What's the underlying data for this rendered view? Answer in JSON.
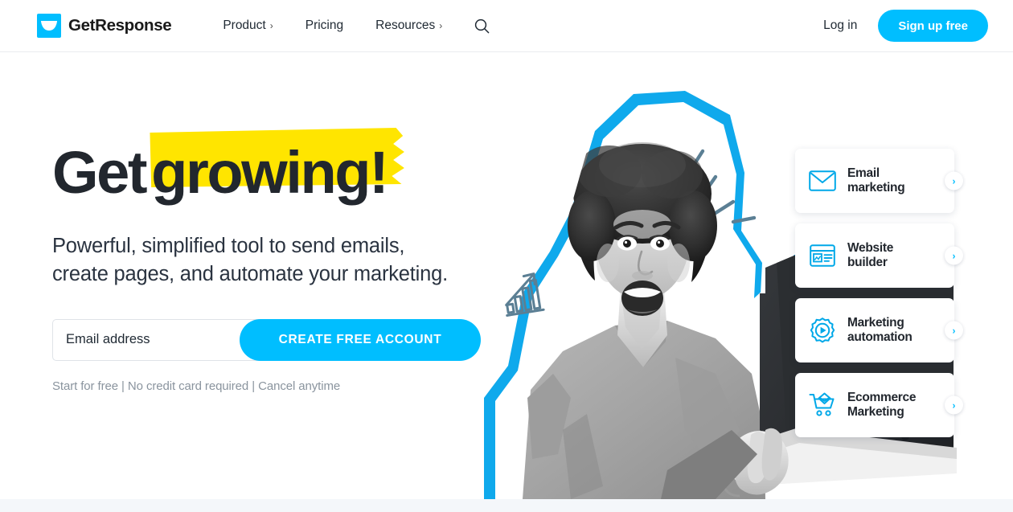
{
  "header": {
    "brand_name": "GetResponse",
    "brand_icon": "envelope-logo-icon",
    "nav": [
      {
        "label": "Product",
        "has_caret": true,
        "caret": "›"
      },
      {
        "label": "Pricing",
        "has_caret": false,
        "caret": ""
      },
      {
        "label": "Resources",
        "has_caret": true,
        "caret": "›"
      }
    ],
    "search_icon": "search-icon",
    "login_label": "Log in",
    "signup_label": "Sign up free"
  },
  "hero": {
    "headline_plain": "Get",
    "headline_highlight": "growing!",
    "subhead_line1": "Powerful, simplified tool to send emails,",
    "subhead_line2": "create pages, and automate your marketing.",
    "email_placeholder": "Email address",
    "email_value": "",
    "cta_label": "CREATE FREE ACCOUNT",
    "fineprint": "Start for free | No credit card required | Cancel anytime"
  },
  "cards": [
    {
      "label_line1": "Email",
      "label_line2": "marketing",
      "icon": "envelope-icon",
      "chevron": "›"
    },
    {
      "label_line1": "Website",
      "label_line2": "builder",
      "icon": "webpage-icon",
      "chevron": "›"
    },
    {
      "label_line1": "Marketing",
      "label_line2": "automation",
      "icon": "gear-play-icon",
      "chevron": "›"
    },
    {
      "label_line1": "Ecommerce",
      "label_line2": "Marketing",
      "icon": "shopping-cart-icon",
      "chevron": "›"
    }
  ],
  "artwork": {
    "figure": "smiling-woman-with-laptop-photo",
    "backdrop": "blue-polygon-shape",
    "decor_lines": "excitement-dash-lines",
    "growth_icon": "bar-chart-arrow-icon"
  },
  "colors": {
    "brand_blue": "#00BEFF",
    "highlight_yellow": "#FFE500",
    "text_dark": "#22272e",
    "text_muted": "#8a949e",
    "decor_steel": "#5b7f94",
    "strip_gray": "#f4f7fa"
  }
}
